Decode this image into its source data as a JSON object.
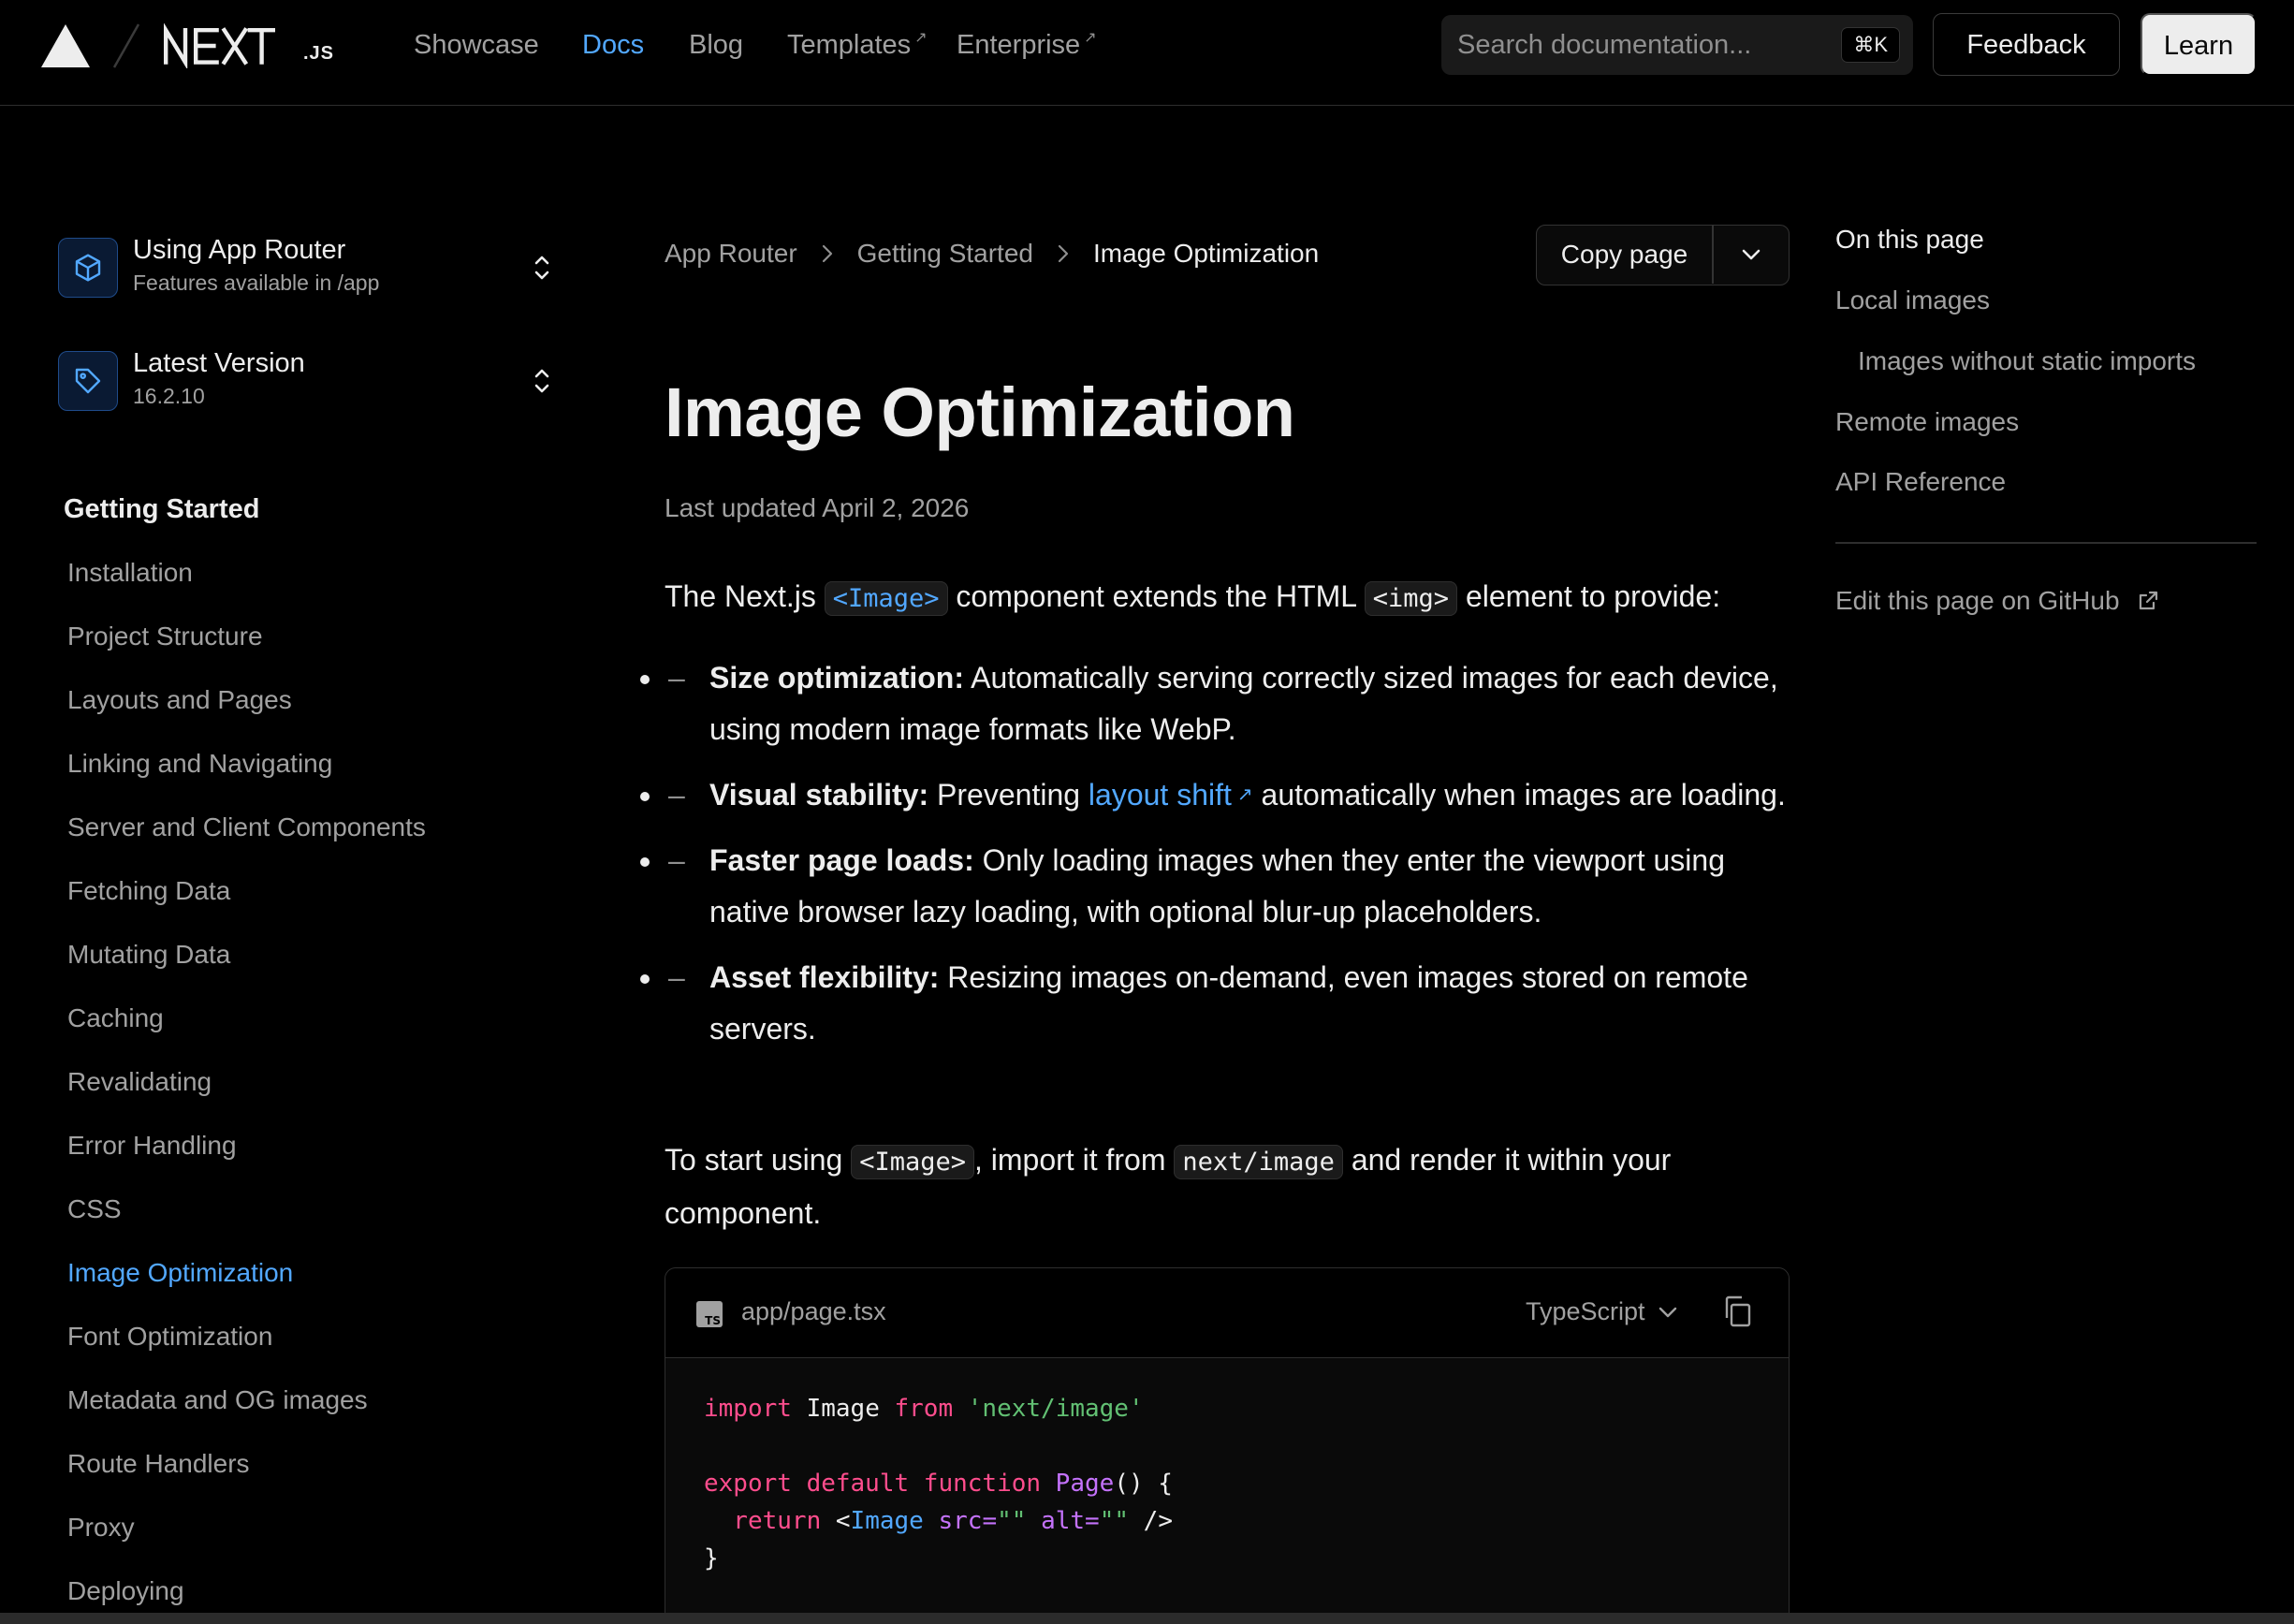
{
  "nav": {
    "links": [
      {
        "label": "Showcase",
        "external": false
      },
      {
        "label": "Docs",
        "external": false
      },
      {
        "label": "Blog",
        "external": false
      },
      {
        "label": "Templates",
        "external": true
      },
      {
        "label": "Enterprise",
        "external": true
      }
    ],
    "active": "Docs",
    "external_glyph": "↗",
    "search_placeholder": "Search documentation...",
    "search_shortcut": "⌘K",
    "feedback_label": "Feedback",
    "learn_label": "Learn",
    "logo_suffix": ".JS"
  },
  "sidebar": {
    "router_selector": {
      "title": "Using App Router",
      "subtitle": "Features available in /app",
      "icon": "cube-icon"
    },
    "version_selector": {
      "title": "Latest Version",
      "subtitle": "16.2.10",
      "icon": "tag-icon"
    },
    "section_heading": "Getting Started",
    "items": [
      {
        "label": "Installation"
      },
      {
        "label": "Project Structure"
      },
      {
        "label": "Layouts and Pages"
      },
      {
        "label": "Linking and Navigating"
      },
      {
        "label": "Server and Client Components"
      },
      {
        "label": "Fetching Data"
      },
      {
        "label": "Mutating Data"
      },
      {
        "label": "Caching"
      },
      {
        "label": "Revalidating"
      },
      {
        "label": "Error Handling"
      },
      {
        "label": "CSS"
      },
      {
        "label": "Image Optimization",
        "active": true
      },
      {
        "label": "Font Optimization"
      },
      {
        "label": "Metadata and OG images"
      },
      {
        "label": "Route Handlers"
      },
      {
        "label": "Proxy"
      },
      {
        "label": "Deploying"
      }
    ]
  },
  "breadcrumb": [
    "App Router",
    "Getting Started",
    "Image Optimization"
  ],
  "copy_page_label": "Copy page",
  "main": {
    "title": "Image Optimization",
    "updated": "Last updated April 2, 2026",
    "intro": {
      "t1": "The Next.js ",
      "c1": "<Image>",
      "t2": " component extends the HTML ",
      "c2": "<img>",
      "t3": " element to provide:"
    },
    "bullets": [
      {
        "bold": "Size optimization:",
        "text": " Automatically serving correctly sized images for each device, using modern image formats like WebP."
      },
      {
        "bold": "Visual stability:",
        "pre": " Preventing ",
        "link": "layout shift",
        "post": " automatically when images are loading."
      },
      {
        "bold": "Faster page loads:",
        "text": " Only loading images when they enter the viewport using native browser lazy loading, with optional blur-up placeholders."
      },
      {
        "bold": "Asset flexibility:",
        "text": " Resizing images on-demand, even images stored on remote servers."
      }
    ],
    "bullet_dash": "–",
    "start": {
      "t1": "To start using ",
      "c1": "<Image>",
      "t2": ", import it from ",
      "c2": "next/image",
      "t3": " and render it within your component."
    },
    "code": {
      "filename": "app/page.tsx",
      "language": "TypeScript",
      "file_badge": "TS",
      "line1": {
        "kw": "import",
        "name": " Image ",
        "kw2": "from",
        "str": " 'next/image'"
      },
      "line2": {
        "kw": "export default function",
        "fn": " Page",
        "rest": "() {"
      },
      "line3": {
        "kw": "  return",
        "lt": " <",
        "tag": "Image",
        "attr1": " src=",
        "v1": "\"\"",
        "attr2": " alt=",
        "v2": "\"\"",
        "end": " />"
      },
      "line4": "}"
    }
  },
  "toc": {
    "title": "On this page",
    "items": [
      "Local images",
      "Images without static imports",
      "Remote images",
      "API Reference"
    ],
    "edit_label": "Edit this page on GitHub"
  },
  "colors": {
    "accent": "#52a8ff",
    "background": "#000000",
    "text": "#ededed",
    "muted": "#a1a1a1"
  }
}
